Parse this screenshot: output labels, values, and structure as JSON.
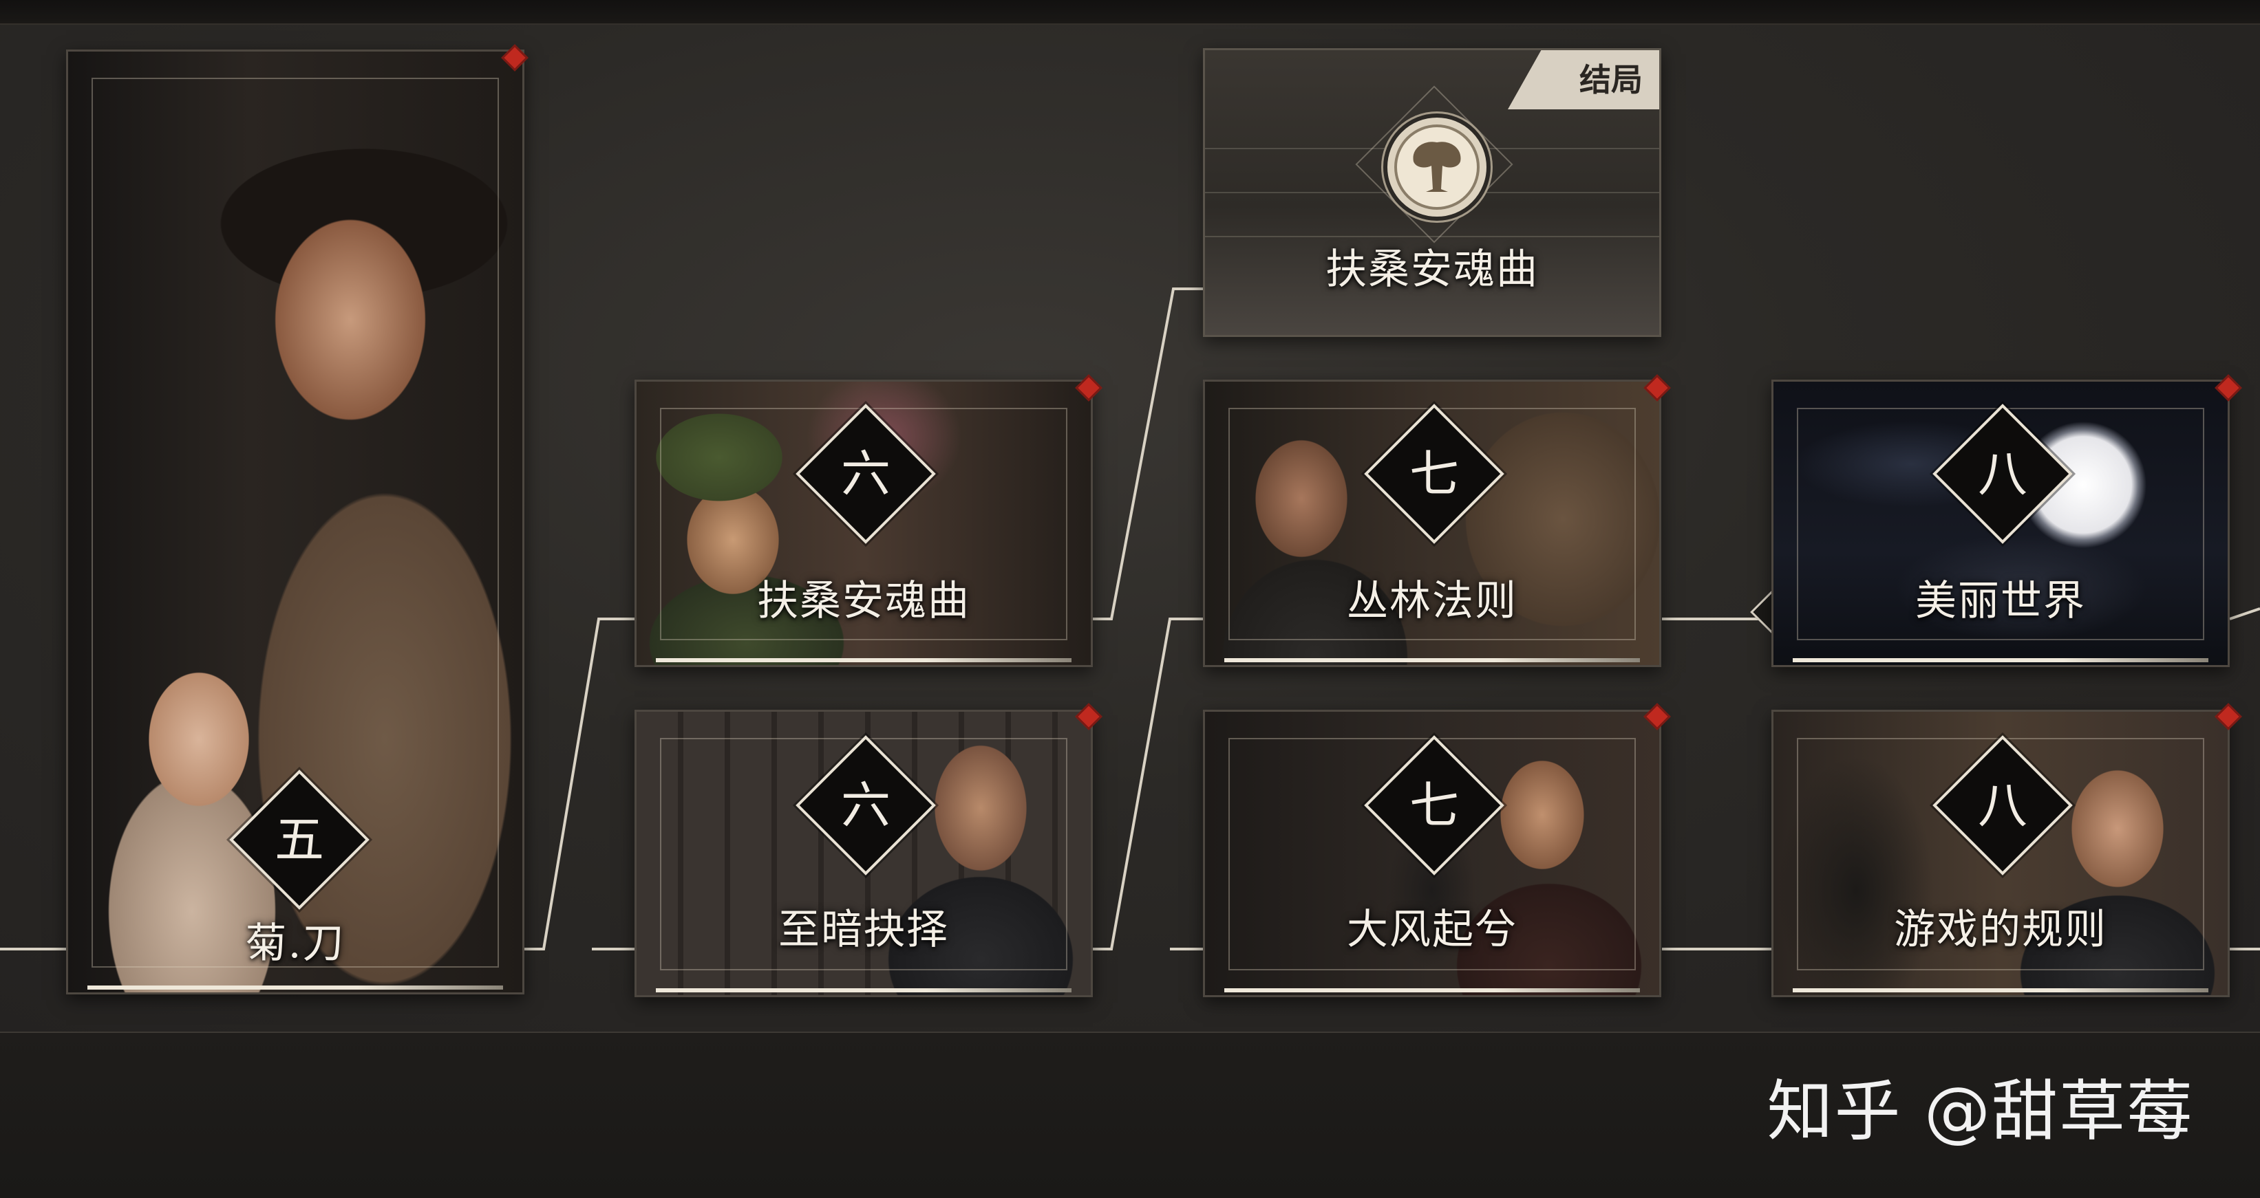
{
  "ending": {
    "tag": "结局",
    "title": "扶桑安魂曲"
  },
  "chapters": {
    "c5": {
      "number": "五",
      "title": "菊.刀"
    },
    "c6a": {
      "number": "六",
      "title": "扶桑安魂曲"
    },
    "c6b": {
      "number": "六",
      "title": "至暗抉择"
    },
    "c7a": {
      "number": "七",
      "title": "丛林法则"
    },
    "c7b": {
      "number": "七",
      "title": "大风起兮"
    },
    "c8a": {
      "number": "八",
      "title": "美丽世界"
    },
    "c8b": {
      "number": "八",
      "title": "游戏的规则"
    }
  },
  "icons": {
    "location": "location-pin-icon",
    "emblem": "mushroom-cloud-icon",
    "new": "red-diamond-marker"
  },
  "watermark": "知乎 @甜草莓",
  "colors": {
    "accent_red": "#c0291f",
    "line": "#d9d2c4",
    "background": "#2b2926"
  }
}
